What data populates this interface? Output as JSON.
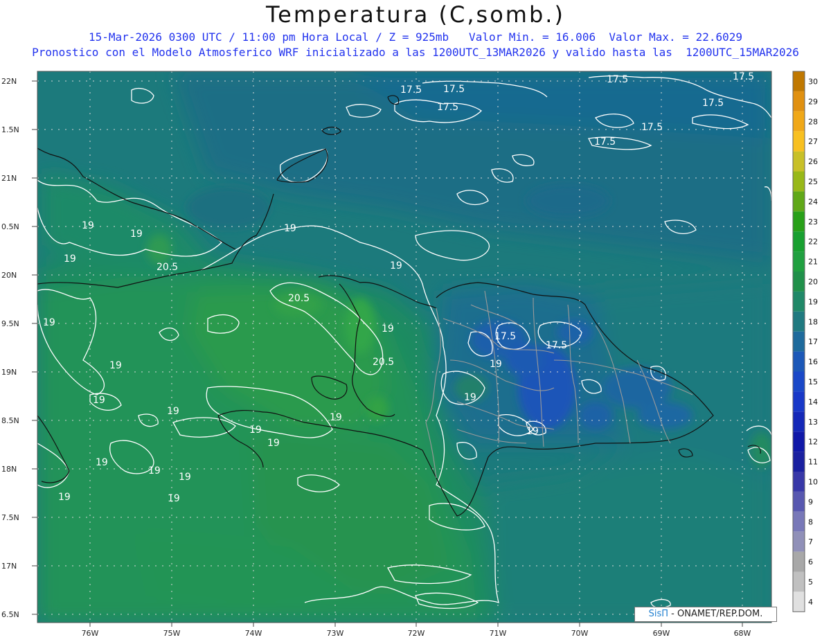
{
  "header": {
    "title": "Temperatura (C,somb.)",
    "line1": "15-Mar-2026 0300 UTC / 11:00 pm Hora Local / Z = 925mb   Valor Min. = 16.006  Valor Max. = 22.6029",
    "line2": "Pronostico con el Modelo Atmosferico WRF inicializado a las 1200UTC_13MAR2026 y valido hasta las  1200UTC_15MAR2026"
  },
  "map": {
    "lat_labels": [
      "22N",
      "1.5N",
      "21N",
      "0.5N",
      "20N",
      "9.5N",
      "19N",
      "8.5N",
      "18N",
      "7.5N",
      "17N",
      "6.5N"
    ],
    "lon_labels": [
      "76W",
      "75W",
      "74W",
      "73W",
      "72W",
      "71W",
      "70W",
      "69W",
      "68W"
    ],
    "contour_labels": [
      "17.5",
      "17.5",
      "17.5",
      "17.5",
      "17.5",
      "17.5",
      "17.5",
      "17.5",
      "17.5",
      "17.5",
      "19",
      "19",
      "19",
      "19",
      "19",
      "19",
      "19",
      "19",
      "19",
      "19",
      "19",
      "19",
      "19",
      "19",
      "19",
      "19",
      "19",
      "19",
      "19",
      "19",
      "19",
      "20.5",
      "20.5",
      "20.5"
    ]
  },
  "colorbar": {
    "labels": [
      "30",
      "29",
      "28",
      "27",
      "26",
      "25",
      "24",
      "23",
      "22",
      "21",
      "20",
      "19",
      "18",
      "17",
      "16",
      "15",
      "14",
      "13",
      "12",
      "11",
      "10",
      "9",
      "8",
      "7",
      "6",
      "5",
      "4"
    ],
    "colors": [
      "#c07800",
      "#e09010",
      "#f0a818",
      "#f8c020",
      "#c8c028",
      "#98b818",
      "#60a818",
      "#28a018",
      "#18a030",
      "#20a040",
      "#20904a",
      "#208868",
      "#207a80",
      "#1e6a9c",
      "#1c58b8",
      "#1a48c8",
      "#1838c8",
      "#1428b8",
      "#1018a8",
      "#1a20a0",
      "#3838a8",
      "#5858b0",
      "#7878b8",
      "#9090b8",
      "#a8a8a8",
      "#c0c0c0",
      "#e0e0e0"
    ]
  },
  "credit": {
    "brand": "SisΠ",
    "org": " - ONAMET/REP.DOM."
  }
}
